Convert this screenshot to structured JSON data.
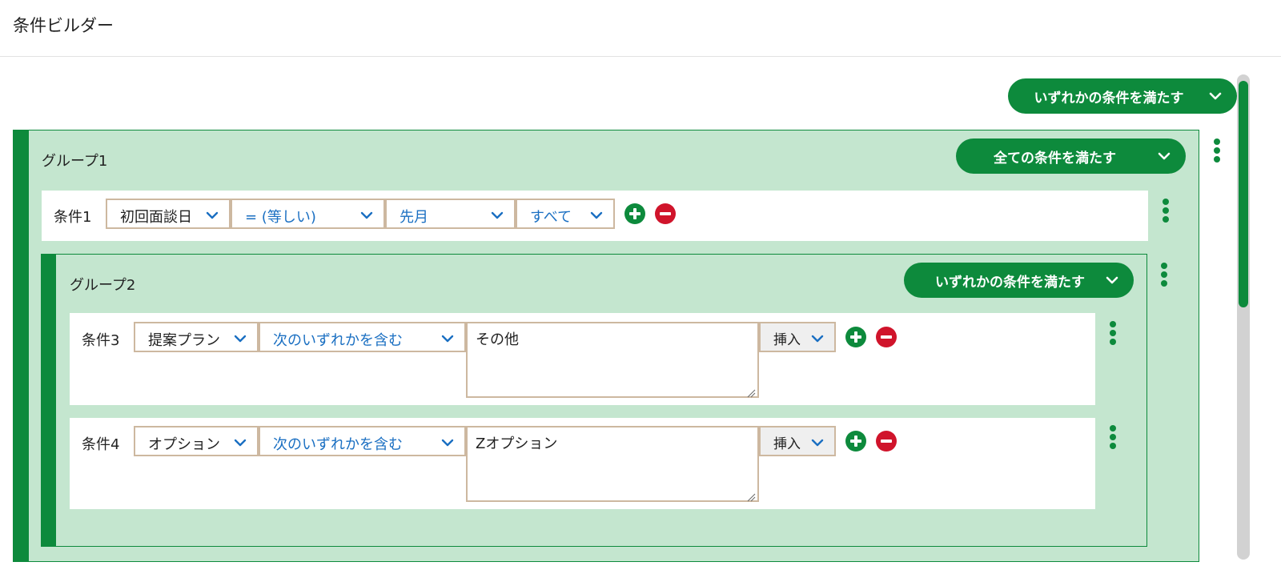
{
  "page": {
    "title": "条件ビルダー"
  },
  "root": {
    "match_label": "いずれかの条件を満たす"
  },
  "group1": {
    "title": "グループ1",
    "match_label": "全ての条件を満たす",
    "condition1": {
      "label": "条件1",
      "field": "初回面談日",
      "operator": "= (等しい)",
      "value": "先月",
      "scope": "すべて"
    }
  },
  "group2": {
    "title": "グループ2",
    "match_label": "いずれかの条件を満たす",
    "condition3": {
      "label": "条件3",
      "field": "提案プラン",
      "operator": "次のいずれかを含む",
      "text": "その他",
      "insert_label": "挿入"
    },
    "condition4": {
      "label": "条件4",
      "field": "オプション",
      "operator": "次のいずれかを含む",
      "text": "Zオプション",
      "insert_label": "挿入"
    }
  },
  "colors": {
    "primary": "#0d8a3c",
    "group_background": "#c4e6cf",
    "danger": "#d0142b",
    "link_text": "#1a6fc2",
    "select_border": "#cdb8a0"
  },
  "icons": [
    "chevron-down-icon",
    "kebab-menu-icon",
    "add-circle-icon",
    "remove-circle-icon",
    "resize-grip-icon"
  ]
}
